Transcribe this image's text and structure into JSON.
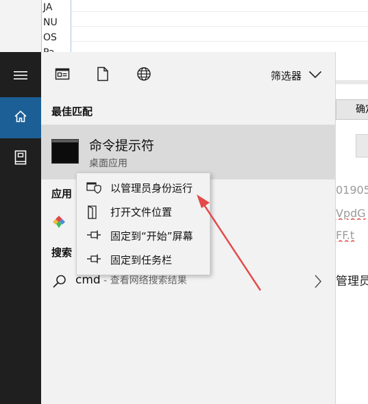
{
  "background": {
    "list_rows": [
      "JA",
      "NU",
      "OS",
      "Pa"
    ],
    "confirm_label": "确定",
    "fragments": {
      "number": "01905",
      "code": "VpdG",
      "ext": "FF.t",
      "admin": "管理员"
    }
  },
  "nav": {
    "menu_icon": "hamburger-icon",
    "home_icon": "home-icon",
    "docs_icon": "document-icon"
  },
  "toolbar": {
    "filter_label": "筛选器"
  },
  "sections": {
    "best_match": "最佳匹配",
    "apps": "应用",
    "search": "搜索"
  },
  "best_match_item": {
    "title": "命令提示符",
    "subtitle": "桌面应用"
  },
  "search_item": {
    "query": "cmd",
    "hint": " - 查看网络搜索结果"
  },
  "context_menu": {
    "items": [
      {
        "label": "以管理员身份运行",
        "icon": "shield-icon"
      },
      {
        "label": "打开文件位置",
        "icon": "open-folder-icon"
      },
      {
        "label": "固定到“开始”屏幕",
        "icon": "pin-icon"
      },
      {
        "label": "固定到任务栏",
        "icon": "pin-icon"
      }
    ]
  },
  "colors": {
    "nav_bg": "#1f1f1f",
    "nav_active": "#1c5f96",
    "menu_bg": "#f2f2f2",
    "selected_bg": "#dadada",
    "annotation_arrow": "#e34a4a"
  }
}
